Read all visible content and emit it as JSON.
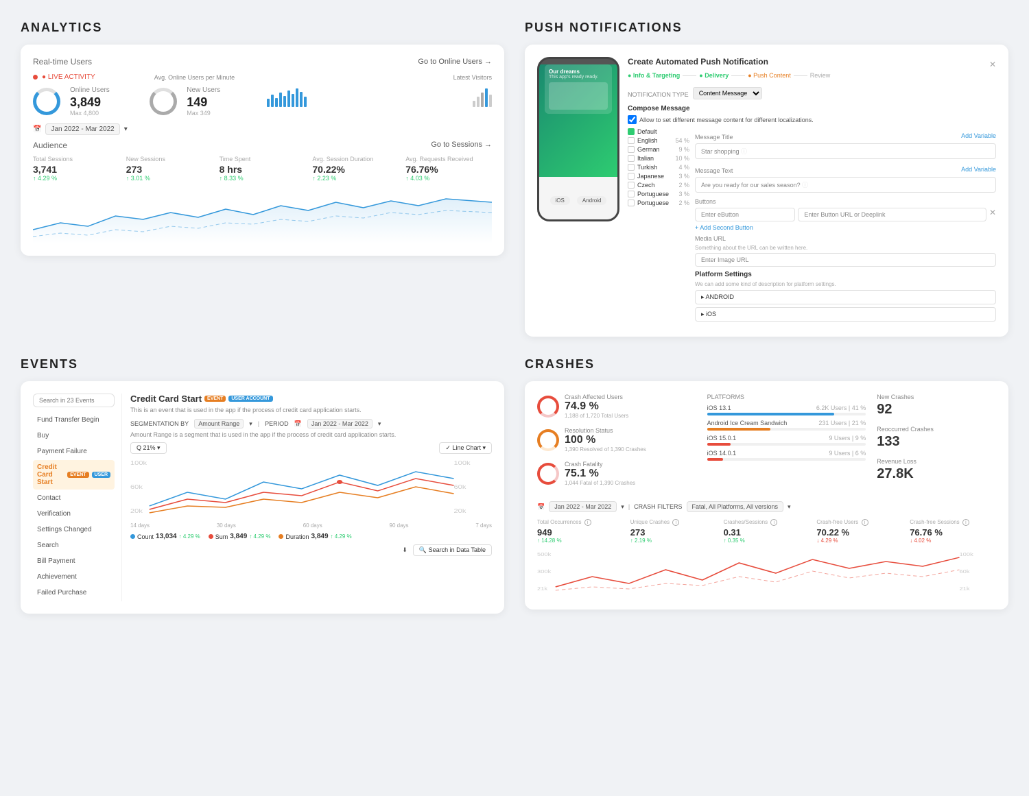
{
  "analytics": {
    "title": "ANALYTICS",
    "realtime_label": "Real-time Users",
    "goto_link": "Go to Online Users →",
    "live_label": "● LIVE ACTIVITY",
    "online_users_label": "Online Users",
    "online_users_value": "3,849",
    "online_users_max": "Max 4,800",
    "new_users_label": "New Users",
    "new_users_value": "149",
    "new_users_max": "Max 349",
    "avg_label": "Avg. Online Users per Minute",
    "latest_label": "Latest Visitors",
    "date_range": "Jan 2022 - Mar 2022",
    "audience_label": "Audience",
    "goto_sessions": "Go to Sessions →",
    "total_sessions_label": "Total Sessions",
    "total_sessions_value": "3,741",
    "total_sessions_change": "↑ 4.29 %",
    "new_sessions_label": "New Sessions",
    "new_sessions_value": "273",
    "new_sessions_change": "↑ 3.01 %",
    "time_spent_label": "Time Spent",
    "time_spent_value": "8 hrs",
    "time_spent_change": "↑ 8.33 %",
    "avg_duration_label": "Avg. Session Duration",
    "avg_duration_value": "70.22%",
    "avg_duration_change": "↑ 2.23 %",
    "avg_requests_label": "Avg. Requests Received",
    "avg_requests_value": "76.76%",
    "avg_requests_change": "↑ 4.03 %"
  },
  "push": {
    "title": "PUSH NOTIFICATIONS",
    "form_title": "Create Automated Push Notification",
    "steps": [
      "Info & Targeting",
      "Delivery",
      "Push Content",
      "Review"
    ],
    "step_active": 2,
    "notification_type_label": "NOTIFICATION TYPE",
    "notification_type_value": "Content Message",
    "compose_label": "Compose Message",
    "allow_diff_label": "Allow to set different message content for different localizations.",
    "locales": [
      {
        "name": "Default",
        "pct": "",
        "checked": true
      },
      {
        "name": "English",
        "pct": "54 %",
        "checked": false
      },
      {
        "name": "German",
        "pct": "9 %",
        "checked": false
      },
      {
        "name": "Italian",
        "pct": "10 %",
        "checked": false
      },
      {
        "name": "Turkish",
        "pct": "4 %",
        "checked": false
      },
      {
        "name": "Japanese",
        "pct": "3 %",
        "checked": false
      },
      {
        "name": "Czech",
        "pct": "2 %",
        "checked": false
      },
      {
        "name": "Portuguese",
        "pct": "3 %",
        "checked": false
      },
      {
        "name": "Portuguese",
        "pct": "2 %",
        "checked": false
      }
    ],
    "msg_title_label": "Message Title",
    "add_variable": "Add Variable",
    "msg_title_placeholder": "Star shopping",
    "msg_text_label": "Message Text",
    "msg_text_placeholder": "Are you ready for our sales season?",
    "buttons_label": "Buttons",
    "btn1_placeholder": "Enter eButton",
    "btn_url_placeholder": "Enter Button URL or Deeplink",
    "add_second_btn": "+ Add Second Button",
    "media_url_label": "Media URL",
    "media_url_desc": "Something about the URL can be written here.",
    "media_url_placeholder": "Enter Image URL",
    "platform_settings_label": "Platform Settings",
    "platform_settings_desc": "We can add some kind of description for platform settings.",
    "android_label": "▸ ANDROID",
    "ios_label": "▸ iOS",
    "ios_btn": "iOS",
    "android_btn": "Android"
  },
  "events": {
    "title": "EVENTS",
    "search_placeholder": "Search in 23 Events",
    "items": [
      {
        "name": "Fund Transfer Begin",
        "active": false
      },
      {
        "name": "Buy",
        "active": false
      },
      {
        "name": "Payment Failure",
        "active": false
      },
      {
        "name": "Credit Card Start",
        "active": true,
        "badge": "EVENT",
        "badge2": "USER ACCOUNT"
      },
      {
        "name": "Contact",
        "active": false
      },
      {
        "name": "Verification",
        "active": false
      },
      {
        "name": "Settings Changed",
        "active": false
      },
      {
        "name": "Search",
        "active": false
      },
      {
        "name": "Bill Payment",
        "active": false
      },
      {
        "name": "Achievement",
        "active": false
      },
      {
        "name": "Failed Purchase",
        "active": false
      }
    ],
    "main_title": "Credit Card Start",
    "main_badge1": "EVENT",
    "main_badge2": "USER ACCOUNT",
    "main_desc": "This is an event that is used in the app if the process of credit card application starts.",
    "seg_label": "SEGMENTATION BY",
    "seg_value": "Amount Range",
    "period_label": "PERIOD",
    "period_value": "Jan 2022 - Mar 2022",
    "seg_desc": "Amount Range is a segment that is used in the app if the process of credit card application starts.",
    "control_pct": "21%",
    "chart_type": "Line Chart",
    "x_labels": [
      "14 days",
      "30 days",
      "60 days",
      "90 days",
      "7 days"
    ],
    "legend": [
      {
        "label": "Count",
        "color": "#3498db",
        "value": "13,034",
        "change": "↑ 4.29 %"
      },
      {
        "label": "Sum",
        "color": "#e74c3c",
        "value": "3,849",
        "change": "↑ 4.29 %"
      },
      {
        "label": "Duration",
        "color": "#e67e22",
        "value": "3,849",
        "change": "↑ 4.29 %"
      }
    ],
    "download_label": "⬇",
    "search_data_label": "Search in Data Table"
  },
  "crashes": {
    "title": "CRASHES",
    "crash_affected_label": "Crash Affected Users",
    "crash_affected_pct": "74.9 %",
    "crash_affected_sub": "1,188 of 1,720 Total Users",
    "resolution_label": "Resolution Status",
    "resolution_pct": "100 %",
    "resolution_sub": "1,390 Resolved of 1,390 Crashes",
    "fatality_label": "Crash Fatality",
    "fatality_pct": "75.1 %",
    "fatality_sub": "1,044 Fatal of 1,390 Crashes",
    "platforms_label": "PLATFORMS",
    "platforms": [
      {
        "name": "iOS 13.1",
        "users": "6.2K Users",
        "pct": "41 %",
        "bar": 80,
        "color": "#3498db"
      },
      {
        "name": "Android Ice Cream Sandwich",
        "users": "231 Users",
        "pct": "21 %",
        "bar": 40,
        "color": "#e67e22"
      },
      {
        "name": "iOS 15.0.1",
        "users": "9 Users",
        "pct": "9 %",
        "bar": 15,
        "color": "#e74c3c"
      },
      {
        "name": "iOS 14.0.1",
        "users": "9 Users",
        "pct": "6 %",
        "bar": 10,
        "color": "#e74c3c"
      }
    ],
    "new_crashes_label": "New Crashes",
    "new_crashes_value": "92",
    "reoccurred_label": "Reoccurred Crashes",
    "reoccurred_value": "133",
    "revenue_loss_label": "Revenue Loss",
    "revenue_loss_value": "27.8K",
    "date_range": "Jan 2022 - Mar 2022",
    "crash_filters_label": "CRASH FILTERS",
    "crash_filters_value": "Fatal, All Platforms, All versions",
    "bottom_metrics": [
      {
        "label": "Total Occurrences",
        "value": "949",
        "change": "↑ 14.28 %"
      },
      {
        "label": "Unique Crashes",
        "value": "273",
        "change": "↑ 2.19 %"
      },
      {
        "label": "Crashes/Sessions",
        "value": "0.31",
        "change": "↑ 0.35 %"
      },
      {
        "label": "Crash-free Users",
        "value": "70.22 %",
        "change": "↓ 4.29 %"
      },
      {
        "label": "Crash-free Sessions",
        "value": "76.76 %",
        "change": "↓ 4.02 %"
      }
    ]
  }
}
